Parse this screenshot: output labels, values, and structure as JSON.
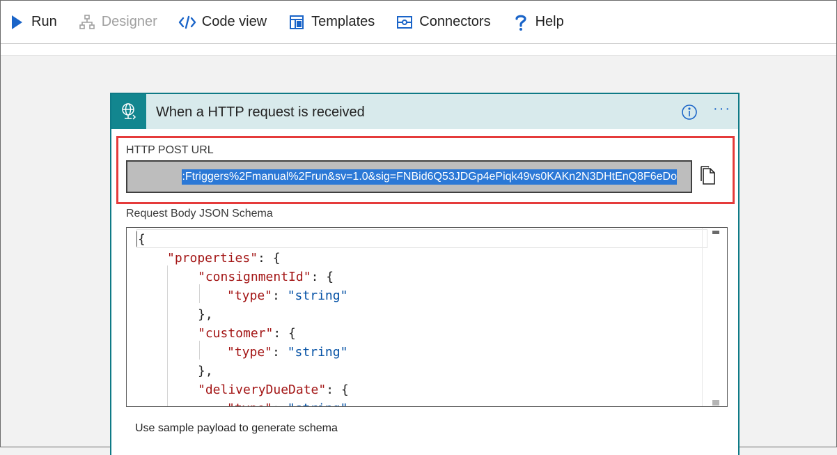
{
  "toolbar": {
    "run": "Run",
    "designer": "Designer",
    "code_view": "Code view",
    "templates": "Templates",
    "connectors": "Connectors",
    "help": "Help"
  },
  "trigger": {
    "title": "When a HTTP request is received",
    "url_label": "HTTP POST URL",
    "url_value": ":Ftriggers%2Fmanual%2Frun&sv=1.0&sig=FNBid6Q53JDGp4ePiqk49vs0KAKn2N3DHtEnQ8F6eDo",
    "schema_label": "Request Body JSON Schema",
    "sample_link": "Use sample payload to generate schema"
  },
  "schema_lines": [
    "{",
    "\"properties\": {",
    "\"consignmentId\": {",
    "\"type\": \"string\"",
    "},",
    "\"customer\": {",
    "\"type\": \"string\"",
    "},",
    "\"deliveryDueDate\": {",
    "\"type\": \"string\""
  ],
  "colors": {
    "accent": "#12868f",
    "highlight_border": "#e53b3b",
    "selection": "#2b78d6",
    "json_key": "#a31515",
    "json_string": "#0451a5"
  }
}
